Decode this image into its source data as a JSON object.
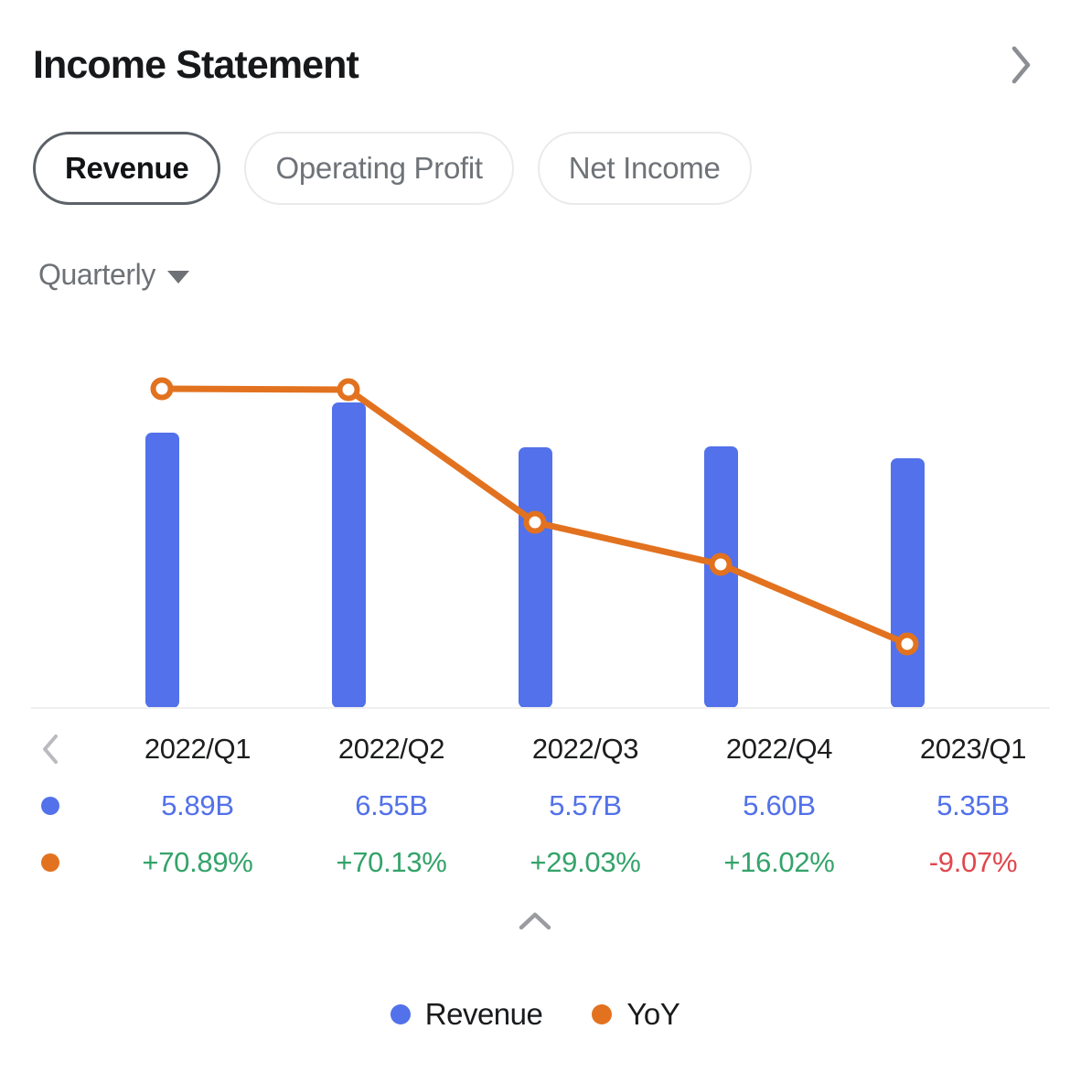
{
  "header": {
    "title": "Income Statement",
    "expand_icon": "chevron-right-icon"
  },
  "tabs": [
    {
      "label": "Revenue",
      "active": true
    },
    {
      "label": "Operating Profit",
      "active": false
    },
    {
      "label": "Net Income",
      "active": false
    }
  ],
  "period_selector": {
    "label": "Quarterly",
    "icon": "caret-down-icon"
  },
  "navigation": {
    "prev_icon": "chevron-left-icon",
    "collapse_icon": "chevron-up-icon"
  },
  "colors": {
    "revenue": "#5271ea",
    "yoy": "#e2721f",
    "positive": "#34a36a",
    "negative": "#e0474d",
    "axis": "#efefef",
    "tab_active_border": "#5c6169",
    "tab_inactive_border": "#eaeaea",
    "muted_text": "#6e7175"
  },
  "legend": [
    {
      "label": "Revenue",
      "color": "#5271ea",
      "marker": "dot"
    },
    {
      "label": "YoY",
      "color": "#e2721f",
      "marker": "dot"
    }
  ],
  "table": {
    "periods": [
      "2022/Q1",
      "2022/Q2",
      "2022/Q3",
      "2022/Q4",
      "2023/Q1"
    ],
    "revenue": [
      "5.89B",
      "6.55B",
      "5.57B",
      "5.60B",
      "5.35B"
    ],
    "yoy": [
      "+70.89%",
      "+70.13%",
      "+29.03%",
      "+16.02%",
      "-9.07%"
    ],
    "yoy_sign": [
      "positive",
      "positive",
      "positive",
      "positive",
      "negative"
    ]
  },
  "chart_data": {
    "type": "bar",
    "title": "Income Statement — Revenue",
    "subtitle": "Quarterly",
    "xlabel": "",
    "ylabel": "",
    "grid": false,
    "legend_position": "bottom",
    "categories": [
      "2022/Q1",
      "2022/Q2",
      "2022/Q3",
      "2022/Q4",
      "2023/Q1"
    ],
    "series": [
      {
        "name": "Revenue",
        "type": "bar",
        "unit": "USD",
        "axis": "left",
        "color": "#5271ea",
        "labels": [
          "5.89B",
          "6.55B",
          "5.57B",
          "5.60B",
          "5.35B"
        ],
        "values": [
          5.89,
          6.55,
          5.57,
          5.6,
          5.35
        ],
        "ylim": [
          0,
          7.3
        ]
      },
      {
        "name": "YoY",
        "type": "line",
        "unit": "percent",
        "axis": "right",
        "color": "#e2721f",
        "marker": "open-circle",
        "labels": [
          "+70.89%",
          "+70.13%",
          "+29.03%",
          "+16.02%",
          "-9.07%"
        ],
        "values": [
          70.89,
          70.13,
          29.03,
          16.02,
          -9.07
        ],
        "ylim": [
          -20,
          80
        ]
      }
    ]
  }
}
